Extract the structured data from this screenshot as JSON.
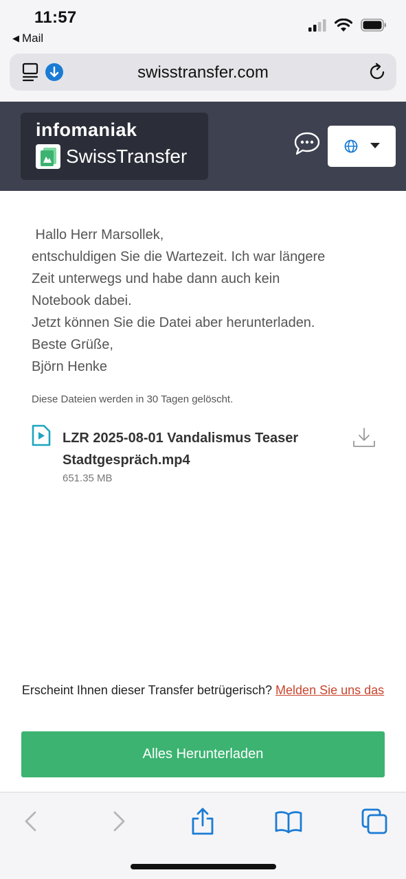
{
  "status_bar": {
    "time": "11:57",
    "back_app": "Mail",
    "icons": [
      "signal-icon",
      "wifi-icon",
      "battery-icon"
    ]
  },
  "browser": {
    "url": "swisstransfer.com"
  },
  "header": {
    "brand_top": "infomaniak",
    "brand_name": "SwissTransfer",
    "accent_color": "#3d4150"
  },
  "message": {
    "lines": [
      " Hallo Herr Marsollek,",
      "entschuldigen Sie die Wartezeit. Ich war längere",
      "Zeit unterwegs und habe dann auch kein",
      "Notebook dabei.",
      "Jetzt können Sie die Datei aber herunterladen.",
      "Beste Grüße,",
      "Björn Henke"
    ]
  },
  "expiry_note": "Diese Dateien werden in 30 Tagen gelöscht.",
  "file": {
    "name": "LZR 2025-08-01 Vandalismus Teaser Stadtgespräch.mp4",
    "size": "651.35 MB"
  },
  "report": {
    "question": "Erscheint Ihnen dieser Transfer betrügerisch? ",
    "link": "Melden Sie uns das"
  },
  "download_all_label": "Alles Herunterladen",
  "colors": {
    "download_button": "#3cb371",
    "report_link": "#c9452d",
    "ios_blue": "#1a7bd4"
  }
}
